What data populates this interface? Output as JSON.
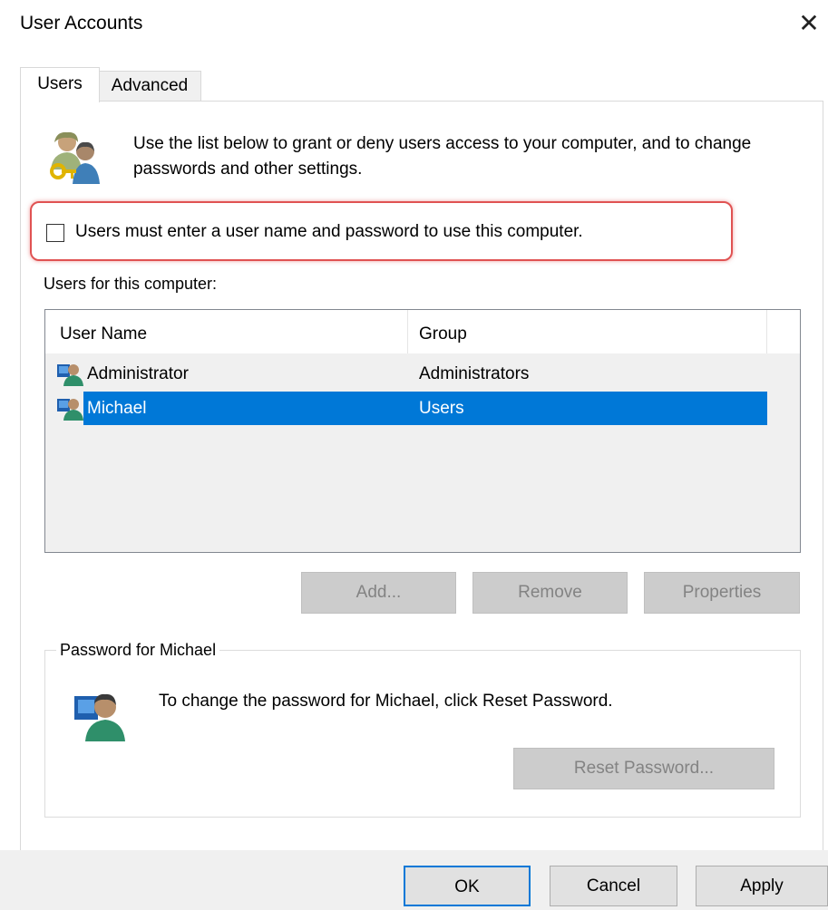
{
  "window": {
    "title": "User Accounts",
    "close_icon": "close-icon"
  },
  "tabs": [
    {
      "label": "Users",
      "active": true
    },
    {
      "label": "Advanced",
      "active": false
    }
  ],
  "header": {
    "icon": "users-keys-icon",
    "text": "Use the list below to grant or deny users access to your computer, and to change passwords and other settings."
  },
  "require_login": {
    "label": "Users must enter a user name and password to use this computer.",
    "checked": false,
    "highlight_color": "#e05252"
  },
  "users_list": {
    "label": "Users for this computer:",
    "columns": [
      "User Name",
      "Group"
    ],
    "rows": [
      {
        "user": "Administrator",
        "group": "Administrators",
        "icon": "user-icon",
        "selected": false
      },
      {
        "user": "Michael",
        "group": "Users",
        "icon": "user-icon",
        "selected": true
      }
    ],
    "selection_color": "#0078d7"
  },
  "list_buttons": {
    "add": "Add...",
    "remove": "Remove",
    "properties": "Properties"
  },
  "password_group": {
    "title": "Password for Michael",
    "icon": "user-icon",
    "text": "To change the password for Michael, click Reset Password.",
    "reset_button": "Reset Password..."
  },
  "footer": {
    "ok": "OK",
    "cancel": "Cancel",
    "apply": "Apply",
    "accent": "#0078d7"
  }
}
